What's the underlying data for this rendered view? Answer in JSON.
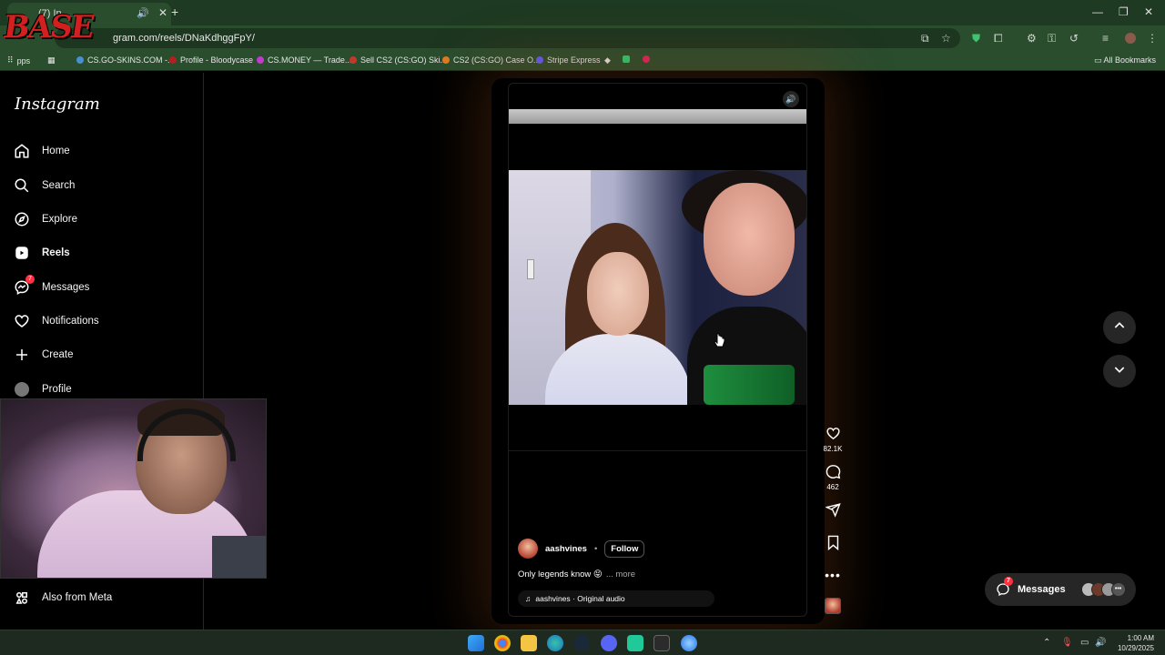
{
  "browser": {
    "tab_title": "(7) In",
    "url": "gram.com/reels/DNaKdhggFpY/",
    "bookmarks": [
      {
        "label": "pps",
        "color": "#8aa"
      },
      {
        "label": "CS.GO-SKINS.COM -...",
        "color": "#4a8fd4"
      },
      {
        "label": "Profile - Bloodycase",
        "color": "#b32020"
      },
      {
        "label": "CS.MONEY — Trade...",
        "color": "#c43ad0"
      },
      {
        "label": "Sell CS2 (CS:GO) Ski...",
        "color": "#c0392b"
      },
      {
        "label": "CS2 (CS:GO) Case O...",
        "color": "#e07b1f"
      },
      {
        "label": "Stripe Express",
        "color": "#635bff"
      }
    ],
    "all_bookmarks": "All Bookmarks"
  },
  "overlay_logo": "BASE",
  "instagram": {
    "brand": "Instagram",
    "nav": [
      {
        "label": "Home",
        "icon": "home-icon"
      },
      {
        "label": "Search",
        "icon": "search-icon"
      },
      {
        "label": "Explore",
        "icon": "compass-icon"
      },
      {
        "label": "Reels",
        "icon": "reels-icon",
        "active": true
      },
      {
        "label": "Messages",
        "icon": "messenger-icon",
        "badge": "7"
      },
      {
        "label": "Notifications",
        "icon": "heart-icon"
      },
      {
        "label": "Create",
        "icon": "plus-icon"
      },
      {
        "label": "Profile",
        "icon": "avatar-icon"
      }
    ],
    "also_from_meta": "Also from Meta"
  },
  "reel": {
    "username": "aashvines",
    "separator": "•",
    "follow_label": "Follow",
    "caption": "Only legends know 😝",
    "more_label": "... more",
    "audio": "aashvines · Original audio",
    "likes": "82.1K",
    "comments": "462"
  },
  "messages_float": {
    "label": "Messages",
    "badge": "7"
  },
  "taskbar": {
    "time": "1:00 AM",
    "date": "10/29/2025"
  },
  "colors": {
    "chrome_green": "#2a4d2e",
    "badge_red": "#ff3040"
  }
}
